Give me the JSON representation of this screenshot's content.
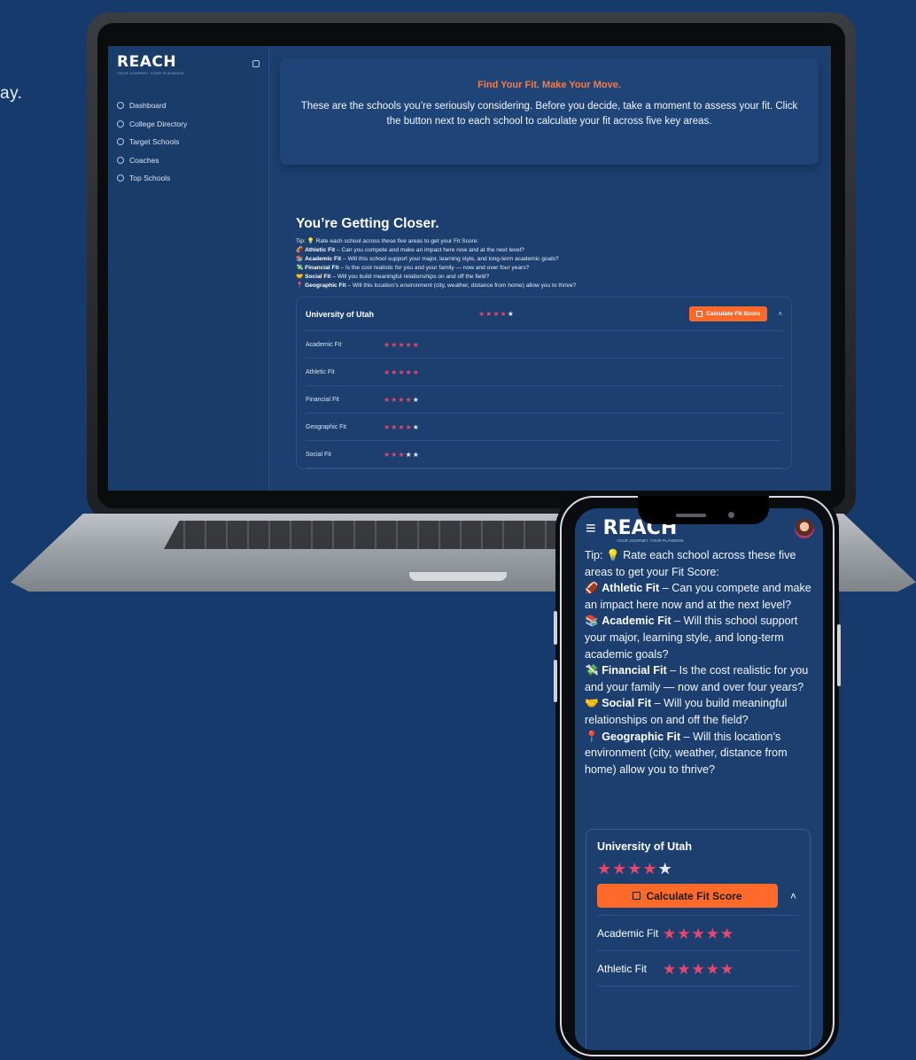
{
  "background_fragment": "ay.",
  "colors": {
    "accent": "#ff6a2b",
    "star_on": "#e8466b",
    "star_off": "#e9ecf1",
    "bg": "#163a6b"
  },
  "sidebar": {
    "logo": "REACH",
    "tagline": "YOUR JOURNEY. YOUR PLAYBOOK",
    "items": [
      {
        "label": "Dashboard",
        "icon": "dashboard-icon"
      },
      {
        "label": "College Directory",
        "icon": "building-icon"
      },
      {
        "label": "Target Schools",
        "icon": "target-icon"
      },
      {
        "label": "Coaches",
        "icon": "users-icon"
      },
      {
        "label": "Top Schools",
        "icon": "star-icon"
      }
    ]
  },
  "hero": {
    "title": "Find Your Fit. Make Your Move.",
    "text": "These are the schools you’re seriously considering. Before you decide, take a moment to assess your fit. Click the button next to each school to calculate your fit across five key areas."
  },
  "section": {
    "title": "You’re Getting Closer.",
    "tip_intro": "Tip: 💡 Rate each school across these five areas to get your Fit Score:",
    "tips": [
      {
        "emoji": "🏈",
        "label": "Athletic Fit",
        "text": " – Can you compete and make an impact here now and at the next level?"
      },
      {
        "emoji": "📚",
        "label": "Academic Fit",
        "text": " – Will this school support your major, learning style, and long-term academic goals?"
      },
      {
        "emoji": "💸",
        "label": "Financial Fit",
        "text": " – Is the cost realistic for you and your family — now and over four years?"
      },
      {
        "emoji": "🤝",
        "label": "Social Fit",
        "text": " – Will you build meaningful relationships on and off the field?"
      },
      {
        "emoji": "📍",
        "label": "Geographic Fit",
        "text": " – Will this location’s environment (city, weather, distance from home) allow you to thrive?"
      }
    ]
  },
  "school": {
    "name": "University of Utah",
    "rating": 4,
    "button": "Calculate Fit Score",
    "fits": [
      {
        "label": "Academic Fit",
        "rating": 5
      },
      {
        "label": "Athletic Fit",
        "rating": 5
      },
      {
        "label": "Financial Fit",
        "rating": 4
      },
      {
        "label": "Geographic Fit",
        "rating": 4
      },
      {
        "label": "Social Fit",
        "rating": 3
      }
    ]
  },
  "phone": {
    "logo": "REACH",
    "tagline": "YOUR JOURNEY. YOUR PLAYBOOK",
    "fits": [
      {
        "label": "Academic Fit",
        "rating": 5
      },
      {
        "label": "Athletic Fit",
        "rating": 5
      }
    ]
  }
}
